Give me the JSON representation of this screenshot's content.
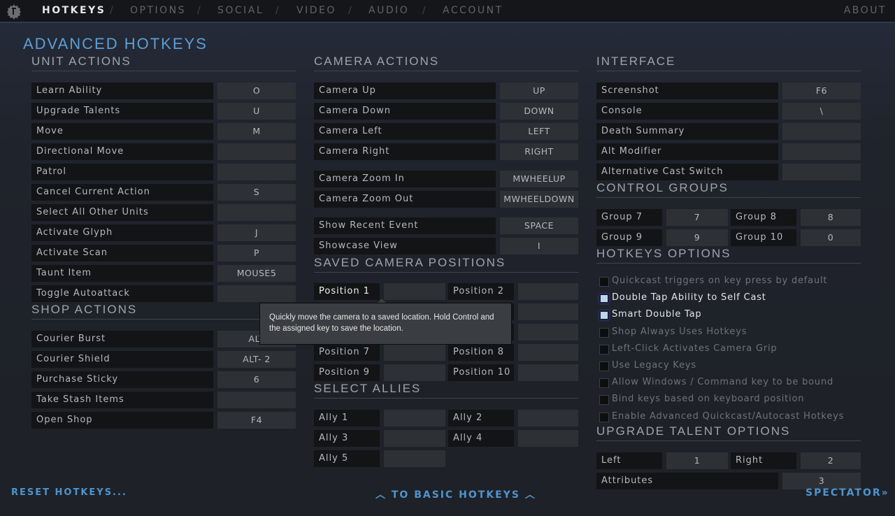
{
  "nav": {
    "tabs": [
      "HOTKEYS",
      "OPTIONS",
      "SOCIAL",
      "VIDEO",
      "AUDIO",
      "ACCOUNT"
    ],
    "active": "HOTKEYS",
    "about": "ABOUT",
    "separator": "/"
  },
  "title": "ADVANCED HOTKEYS",
  "unit_actions": {
    "header": "UNIT ACTIONS",
    "rows": [
      [
        "Learn Ability",
        "O"
      ],
      [
        "Upgrade Talents",
        "U"
      ],
      [
        "Move",
        "M"
      ],
      [
        "Directional Move",
        ""
      ],
      [
        "Patrol",
        ""
      ],
      [
        "Cancel Current Action",
        "S"
      ],
      [
        "Select All Other Units",
        ""
      ],
      [
        "Activate Glyph",
        "J"
      ],
      [
        "Activate Scan",
        "P"
      ],
      [
        "Taunt Item",
        "MOUSE5"
      ],
      [
        "Toggle Autoattack",
        ""
      ]
    ]
  },
  "shop_actions": {
    "header": "SHOP ACTIONS",
    "rows": [
      [
        "Courier Burst",
        "ALT"
      ],
      [
        "Courier Shield",
        "ALT- 2"
      ],
      [
        "Purchase Sticky",
        "6"
      ],
      [
        "Take Stash Items",
        ""
      ],
      [
        "Open Shop",
        "F4"
      ]
    ]
  },
  "camera_actions": {
    "header": "CAMERA ACTIONS",
    "rows": [
      [
        "Camera Up",
        "UP"
      ],
      [
        "Camera Down",
        "DOWN"
      ],
      [
        "Camera Left",
        "LEFT"
      ],
      [
        "Camera Right",
        "RIGHT"
      ],
      [
        "Camera Zoom In",
        "MWHEELUP"
      ],
      [
        "Camera Zoom Out",
        "MWHEELDOWN"
      ],
      [
        "Show Recent Event",
        "SPACE"
      ],
      [
        "Showcase View",
        "I"
      ]
    ]
  },
  "saved_camera": {
    "header": "SAVED CAMERA POSITIONS",
    "rows": [
      [
        [
          "Position 1",
          ""
        ],
        [
          "Position 2",
          ""
        ]
      ],
      [
        [
          "",
          ""
        ],
        [
          "",
          ""
        ]
      ],
      [
        [
          "",
          ""
        ],
        [
          "",
          ""
        ]
      ],
      [
        [
          "Position 7",
          ""
        ],
        [
          "Position 8",
          ""
        ]
      ],
      [
        [
          "Position 9",
          ""
        ],
        [
          "Position 10",
          ""
        ]
      ]
    ]
  },
  "select_allies": {
    "header": "SELECT ALLIES",
    "rows": [
      [
        [
          "Ally 1",
          ""
        ],
        [
          "Ally 2",
          ""
        ]
      ],
      [
        [
          "Ally 3",
          ""
        ],
        [
          "Ally 4",
          ""
        ]
      ],
      [
        [
          "Ally 5",
          ""
        ]
      ]
    ]
  },
  "interface": {
    "header": "INTERFACE",
    "rows": [
      [
        "Screenshot",
        "F6"
      ],
      [
        "Console",
        "\\"
      ],
      [
        "Death Summary",
        ""
      ],
      [
        "Alt Modifier",
        ""
      ],
      [
        "Alternative Cast Switch",
        ""
      ]
    ]
  },
  "control_groups": {
    "header": "CONTROL GROUPS",
    "rows": [
      [
        [
          "Group 7",
          "7"
        ],
        [
          "Group 8",
          "8"
        ]
      ],
      [
        [
          "Group 9",
          "9"
        ],
        [
          "Group 10",
          "0"
        ]
      ]
    ]
  },
  "hotkeys_options": {
    "header": "HOTKEYS OPTIONS",
    "items": [
      {
        "label": "Quickcast triggers on key press by default",
        "checked": false
      },
      {
        "label": "Double Tap Ability to Self Cast",
        "checked": true
      },
      {
        "label": "Smart Double Tap",
        "checked": true
      },
      {
        "label": "Shop Always Uses Hotkeys",
        "checked": false
      },
      {
        "label": "Left-Click Activates Camera Grip",
        "checked": false
      },
      {
        "label": "Use Legacy Keys",
        "checked": false
      },
      {
        "label": "Allow Windows / Command key to be bound",
        "checked": false
      },
      {
        "label": "Bind keys based on keyboard position",
        "checked": false
      },
      {
        "label": "Enable Advanced Quickcast/Autocast Hotkeys",
        "checked": false
      }
    ]
  },
  "upgrade_talent": {
    "header": "UPGRADE TALENT OPTIONS",
    "rows": [
      [
        [
          "Left",
          "1"
        ],
        [
          "Right",
          "2"
        ]
      ]
    ],
    "attributes": [
      "Attributes",
      "3"
    ]
  },
  "tooltip": "Quickly move the camera to a saved location. Hold Control and the assigned key to save the location.",
  "footer": {
    "reset": "RESET HOTKEYS...",
    "basic": "TO BASIC HOTKEYS",
    "spectator": "SPECTATOR"
  },
  "colors": {
    "accent": "#4d94d0",
    "title": "#5a9fd6"
  }
}
